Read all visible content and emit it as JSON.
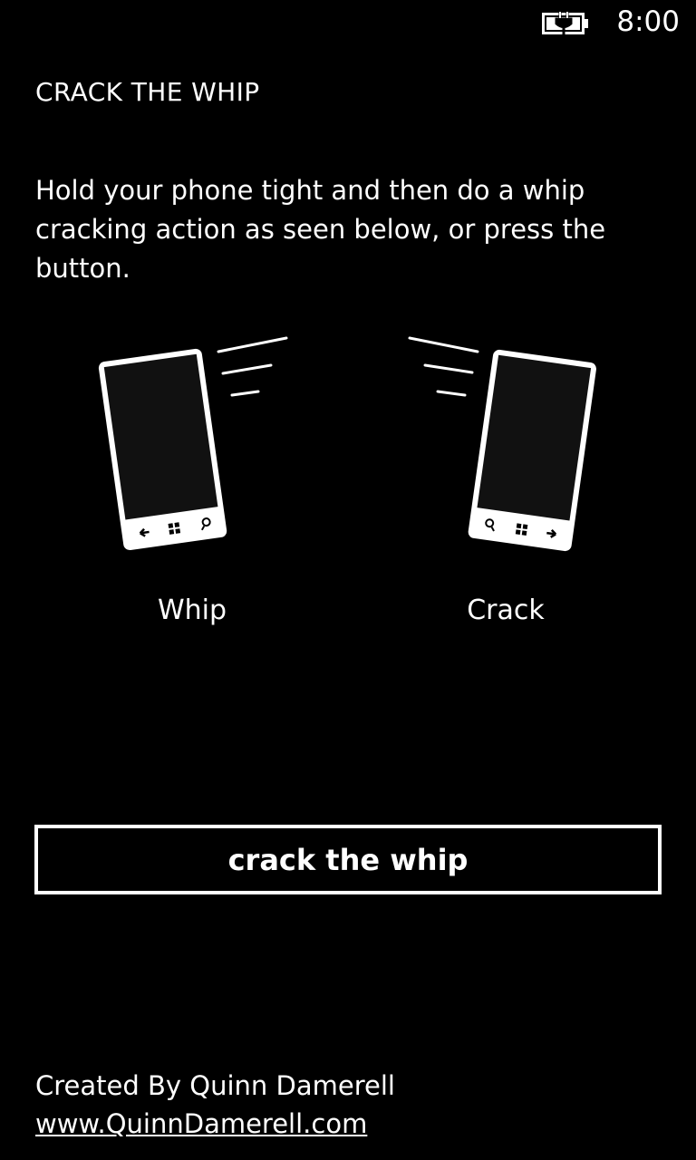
{
  "status_bar": {
    "battery_icon": "battery-charging-icon",
    "time": "8:00"
  },
  "app": {
    "title": "CRACK THE WHIP"
  },
  "instructions": "Hold your phone tight and then do a whip cracking action as seen below, or press the button.",
  "illustrations": [
    {
      "label": "Whip",
      "icon": "phone-whip-icon"
    },
    {
      "label": "Crack",
      "icon": "phone-crack-icon"
    }
  ],
  "action_button": {
    "label": "crack the whip"
  },
  "footer": {
    "credit": "Created By Quinn Damerell",
    "link": "www.QuinnDamerell.com"
  },
  "colors": {
    "background": "#000000",
    "foreground": "#ffffff",
    "screen": "#111111"
  }
}
